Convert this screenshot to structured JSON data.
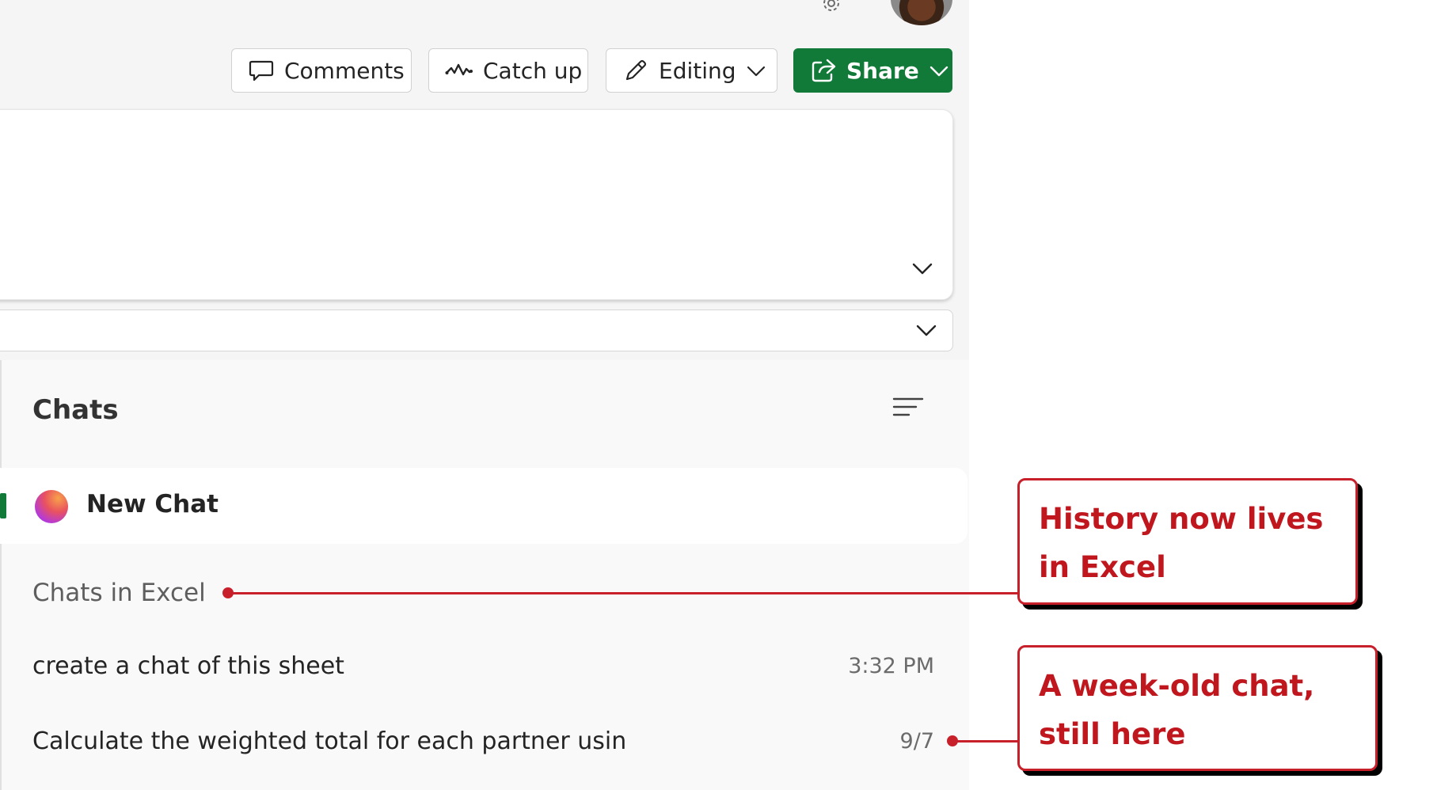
{
  "toolbar": {
    "comments_label": "Comments",
    "catchup_label": "Catch up",
    "editing_label": "Editing",
    "share_label": "Share"
  },
  "chats": {
    "title": "Chats",
    "new_chat_label": "New Chat",
    "section_label": "Chats in Excel",
    "items": [
      {
        "title": "create a chat of this sheet",
        "time": "3:32 PM"
      },
      {
        "title": "Calculate the weighted total for each partner usin",
        "time": "9/7"
      }
    ]
  },
  "annotations": [
    {
      "text": "History now lives in Excel"
    },
    {
      "text": "A week-old chat, still here"
    }
  ],
  "colors": {
    "share_green": "#117a39",
    "annotation_red": "#c8202a",
    "pane_background": "#f5f5f5"
  },
  "icons": {
    "comments": "speech-bubble-icon",
    "catchup": "pulse-wave-icon",
    "editing": "pencil-icon",
    "share": "share-arrow-icon",
    "chats_menu": "menu-lines-icon",
    "new_chat": "copilot-logo-icon"
  }
}
